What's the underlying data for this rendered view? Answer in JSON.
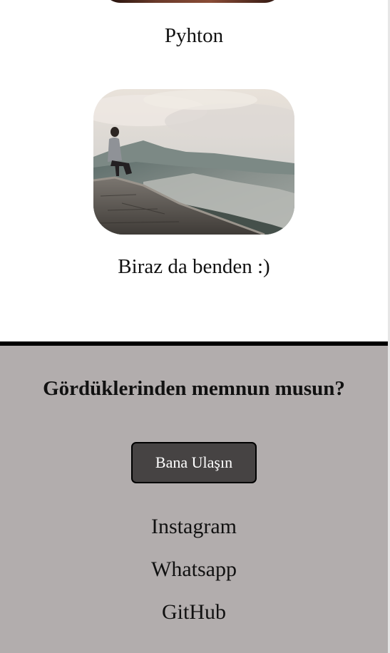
{
  "gallery": {
    "python_caption": "Pyhton",
    "me_caption": "Biraz da benden :)",
    "me_image_alt": "man-sitting-on-stone-wall-photo"
  },
  "footer": {
    "question": "Gördüklerinden memnun musun?",
    "contact_button_label": "Bana Ulaşın",
    "links": [
      {
        "label": "Instagram"
      },
      {
        "label": "Whatsapp"
      },
      {
        "label": "GitHub"
      }
    ],
    "background_color": "#b2adad",
    "button_color": "#464343"
  }
}
